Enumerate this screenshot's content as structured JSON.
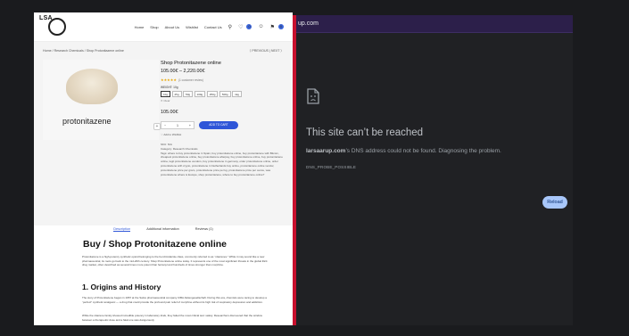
{
  "shop": {
    "logo_text": "LSA",
    "nav": [
      "Home",
      "Shop",
      "About Us",
      "Wishlist",
      "Contact Us"
    ],
    "cart_count": "0",
    "wish_count": "0",
    "breadcrumb": "Home / Research Chemicals / Shop Protonitazene online",
    "pager": "〈 PREVIOUS | NEXT 〉",
    "image_caption": "protonitazene",
    "product_title": "Shop Protonitazene online",
    "price_range": "105.00€ – 2,220.00€",
    "rating": "★★★★★",
    "reviews": "(1 customer review)",
    "weight_label": "WEIGHT: 10g",
    "weight_options": [
      "10g",
      "25g",
      "50g",
      "100g",
      "250g",
      "500g",
      "1kg"
    ],
    "clear_label": "✕ Clear",
    "price": "105.00€",
    "qty": "1",
    "add_to_cart": "ADD TO CART",
    "wishlist": "♡ Add to Wishlist",
    "sku": "SKU: N/A",
    "category": "Category: Research Chemicals",
    "tags": "Tags: where to buy protonitazene in Spain, buy protonitazene online, buy protonitazene with Bitcoin, cheapest protonitazene online, buy protonitazene afterpay, buy protonitazene online, buy protonitazene online, legit protonitazene vendors, buy protonitazene in germany, order protonitazene online, order protonitazene with crypto, protonitazene in Netherlands buy online, protonitazene online vendor, protonitazene price per gram, protonitazene price per kg, protonitazene price per ounce, was protonitazene where is Europe, shop protonitazene, where to buy protonitazene online?",
    "tabs": [
      "Description",
      "Additional information",
      "Reviews (1)"
    ],
    "h1": "Buy / Shop Protonitazene online",
    "para1": "Protonitazene is a high-potency synthetic opioid belonging to the benzimidazole class, commonly referred to as “nitazenes.” While it may sound like a new pharmaceutical, its roots go back to the mid-20th century. Shop Protonitazene online today. It represents one of the most significant threats in the global illicit drug market, often described as several times more potent than fentanyl and hundreds of times stronger than morphine.",
    "h2": "1. Origins and History",
    "para2": "The story of Protonitazene began in 1957 at the Swiss pharmaceutical company CIBA Aktiengesellschaft. During this era, chemists were racing to develop a “perfect” synthetic analgesic — a drug that could provide the profound pain relief of morphine without its high risk of respiratory depression and addiction.",
    "para3": "While the nitazene family showed incredible potency in laboratory trials, they failed the most critical test: safety. Researchers discovered that the window between a therapeutic dose and a fatal one was dangerously"
  },
  "error_page": {
    "url": "up.com",
    "title": "This site can’t be reached",
    "host": "larsaarup.com",
    "message": "’s DNS address could not be found. Diagnosing the problem.",
    "code": "DNS_PROBE_POSSIBLE",
    "reload": "Reload"
  },
  "colors": {
    "accent": "#2f56d8",
    "divider": "#c8102e",
    "error_bg": "#202124",
    "reload_bg": "#a8c7fa"
  }
}
